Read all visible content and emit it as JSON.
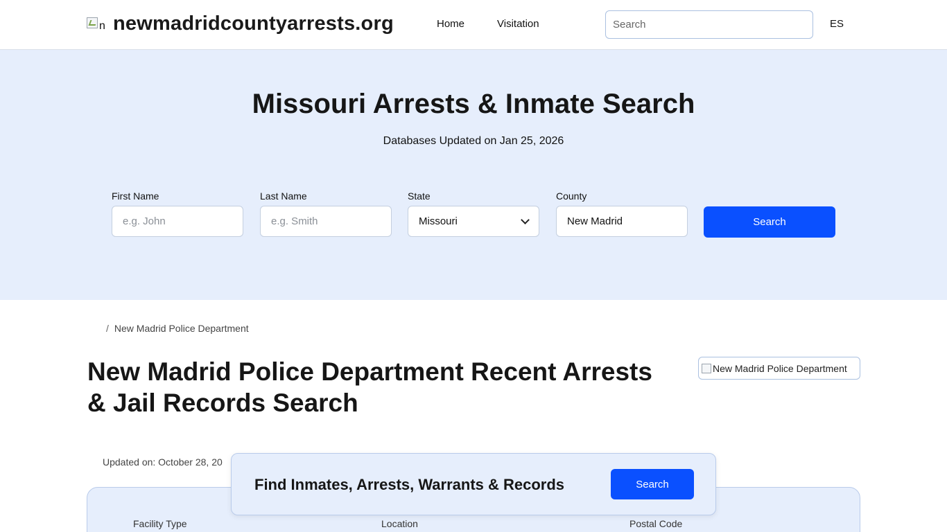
{
  "header": {
    "logo_alt": "n",
    "site_name": "newmadridcountyarrests.org",
    "nav": [
      {
        "label": "Home"
      },
      {
        "label": "Visitation"
      }
    ],
    "search_placeholder": "Search",
    "lang": "ES"
  },
  "hero": {
    "title": "Missouri Arrests & Inmate Search",
    "subtitle": "Databases Updated on Jan 25, 2026",
    "form": {
      "first_name": {
        "label": "First Name",
        "placeholder": "e.g. John"
      },
      "last_name": {
        "label": "Last Name",
        "placeholder": "e.g. Smith"
      },
      "state": {
        "label": "State",
        "value": "Missouri"
      },
      "county": {
        "label": "County",
        "value": "New Madrid"
      },
      "submit": "Search"
    }
  },
  "breadcrumb": {
    "separator": "/",
    "current": "New Madrid Police Department"
  },
  "page": {
    "title": "New Madrid Police Department Recent Arrests & Jail Records Search",
    "image_alt": "New Madrid Police Department",
    "updated": "Updated on: October 28, 20"
  },
  "info_card": {
    "labels": [
      "Facility Type",
      "Location",
      "Postal Code"
    ]
  },
  "cta": {
    "text": "Find Inmates, Arrests, Warrants & Records",
    "button": "Search"
  },
  "colors": {
    "accent": "#0a50ff",
    "hero_bg": "#e6eefc",
    "border": "#b9cbea"
  }
}
